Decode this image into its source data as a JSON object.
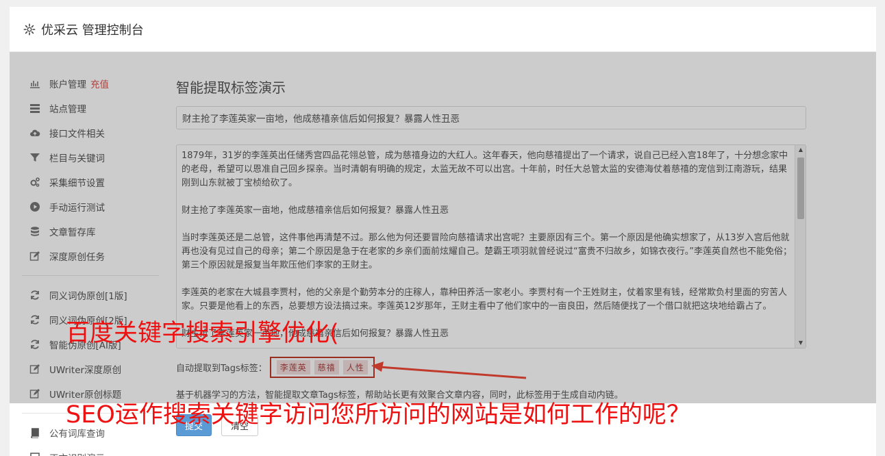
{
  "header": {
    "title": "优采云 管理控制台",
    "icon": "gear-icon"
  },
  "sidebar": {
    "group1": [
      {
        "label": "账户管理",
        "badge": "充值",
        "icon": "bar-chart-icon"
      },
      {
        "label": "站点管理",
        "icon": "server-icon"
      },
      {
        "label": "接口文件相关",
        "icon": "cloud-upload-icon"
      },
      {
        "label": "栏目与关键词",
        "icon": "filter-icon"
      },
      {
        "label": "采集细节设置",
        "icon": "cogs-icon"
      },
      {
        "label": "手动运行测试",
        "icon": "play-circle-icon"
      },
      {
        "label": "文章暂存库",
        "icon": "database-icon"
      },
      {
        "label": "深度原创任务",
        "icon": "edit-icon"
      }
    ],
    "group2": [
      {
        "label": "同义词伪原创[1版]",
        "icon": "refresh-icon"
      },
      {
        "label": "同义词伪原创[2版]",
        "icon": "refresh-icon"
      },
      {
        "label": "智能伪原创[AI版]",
        "icon": "refresh-icon"
      },
      {
        "label": "UWriter深度原创",
        "icon": "edit-icon"
      },
      {
        "label": "UWriter原创标题",
        "icon": "edit-icon"
      }
    ],
    "group3": [
      {
        "label": "公有词库查询",
        "icon": "book-icon"
      },
      {
        "label": "正文识别演示",
        "icon": "square-icon"
      }
    ]
  },
  "main": {
    "page_title": "智能提取标签演示",
    "title_value": "财主抢了李莲英家一亩地，他成慈禧亲信后如何报复？暴露人性丑恶",
    "content_text": "1879年，31岁的李莲英出任储秀宫四品花翎总管，成为慈禧身边的大红人。这年春天，他向慈禧提出了一个请求，说自己已经入宫18年了，十分想念家中的老母，希望可以恩准自己回乡探亲。当时清朝有明确的规定，太监无故不可以出宫。十年前，时任大总管太监的安德海仗着慈禧的宠信到江南游玩，结果刚到山东就被丁宝桢给砍了。\n\n财主抢了李莲英家一亩地，他成慈禧亲信后如何报复？暴露人性丑恶\n\n当时李莲英还是二总管，这件事他再清楚不过。那么他为何还要冒险向慈禧请求出宫呢？主要原因有三个。第一个原因是他确实想家了，从13岁入宫后他就再也没有见过自己的母亲；第二个原因是急于在老家的乡亲们面前炫耀自己。楚霸王项羽就曾经说过“富贵不归故乡，如锦衣夜行。”李莲英自然也不能免俗；第三个原因就是报复当年欺压他们李家的王财主。\n\n李莲英的老家在大城县李贾村，他的父亲是个勤劳本分的庄稼人，靠种田养活一家老小。李贾村有一个王姓财主，仗着家里有钱，经常欺负村里面的穷苦人家。只要是他看上的东西，总要想方设法搞过来。李莲英12岁那年，王财主看中了他们家中的一亩良田，然后随便找了一个借口就把这块地给霸占了。\n\n财主抢了李莲英家一亩地，他成慈禧亲信后如何报复？暴露人性丑恶",
    "tags_label": "自动提取到Tags标签：",
    "tags": [
      "李莲英",
      "慈禧",
      "人性"
    ],
    "description": "基于机器学习的方法，智能提取文章Tags标签，帮助站长更有效聚合文章内容，同时，此标签用于生成自动内链。",
    "submit_label": "提交",
    "clear_label": "清空"
  },
  "overlay": {
    "line1": "百度关键字搜索引擎优化(",
    "line2": "SEO运作搜索关键字访问您所访问的网站是如何工作的呢？"
  },
  "colors": {
    "accent": "#5b9bd5",
    "overlay_text": "#ee1111",
    "badge": "#d9534f"
  }
}
